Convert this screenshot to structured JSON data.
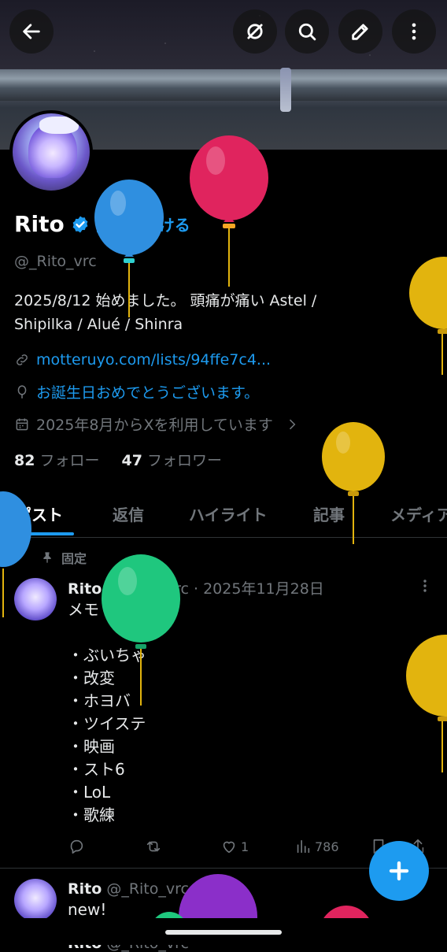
{
  "profile": {
    "name": "Rito",
    "verify_cta": "認証を受ける",
    "handle": "@_Rito_vrc",
    "bio_line1": "2025/8/12 始めました。 頭痛が痛い  Astel /",
    "bio_line2": "Shipilka / Alué / Shinra",
    "link": "motteruyo.com/lists/94ffe7c4...",
    "birthday": "お誕生日おめでとうございます。",
    "joined": "2025年8月からXを利用しています",
    "following_count": "82",
    "following_label": "フォロー",
    "followers_count": "47",
    "followers_label": "フォロワー"
  },
  "tabs": [
    "ポスト",
    "返信",
    "ハイライト",
    "記事",
    "メディア"
  ],
  "pinned_label": "固定",
  "post1": {
    "name": "Rito",
    "meta": "@_Rito_vrc · 2025年11月28日",
    "text": "メモ\n\n・ぶいちゃ\n・改変\n・ホヨバ\n・ツイステ\n・映画\n・スト6\n・LoL\n・歌練",
    "likes": "1",
    "views": "786"
  },
  "post2": {
    "name": "Rito",
    "meta": "@_Rito_vrc · 1日",
    "text": "new!"
  },
  "post3": {
    "name": "Rito",
    "meta": "@_Rito_vrc"
  },
  "colors": {
    "accent": "#1d9bf0",
    "balloon_blue": "#2f8fe0",
    "balloon_red": "#e0245e",
    "balloon_yellow": "#e2b40e",
    "balloon_green": "#1fc77e",
    "balloon_purple": "#8b2fc9"
  },
  "icons": {
    "back": "arrow-left-icon",
    "mute": "circle-slash-icon",
    "search": "search-icon",
    "edit": "pencil-icon",
    "more": "more-vertical-icon"
  }
}
